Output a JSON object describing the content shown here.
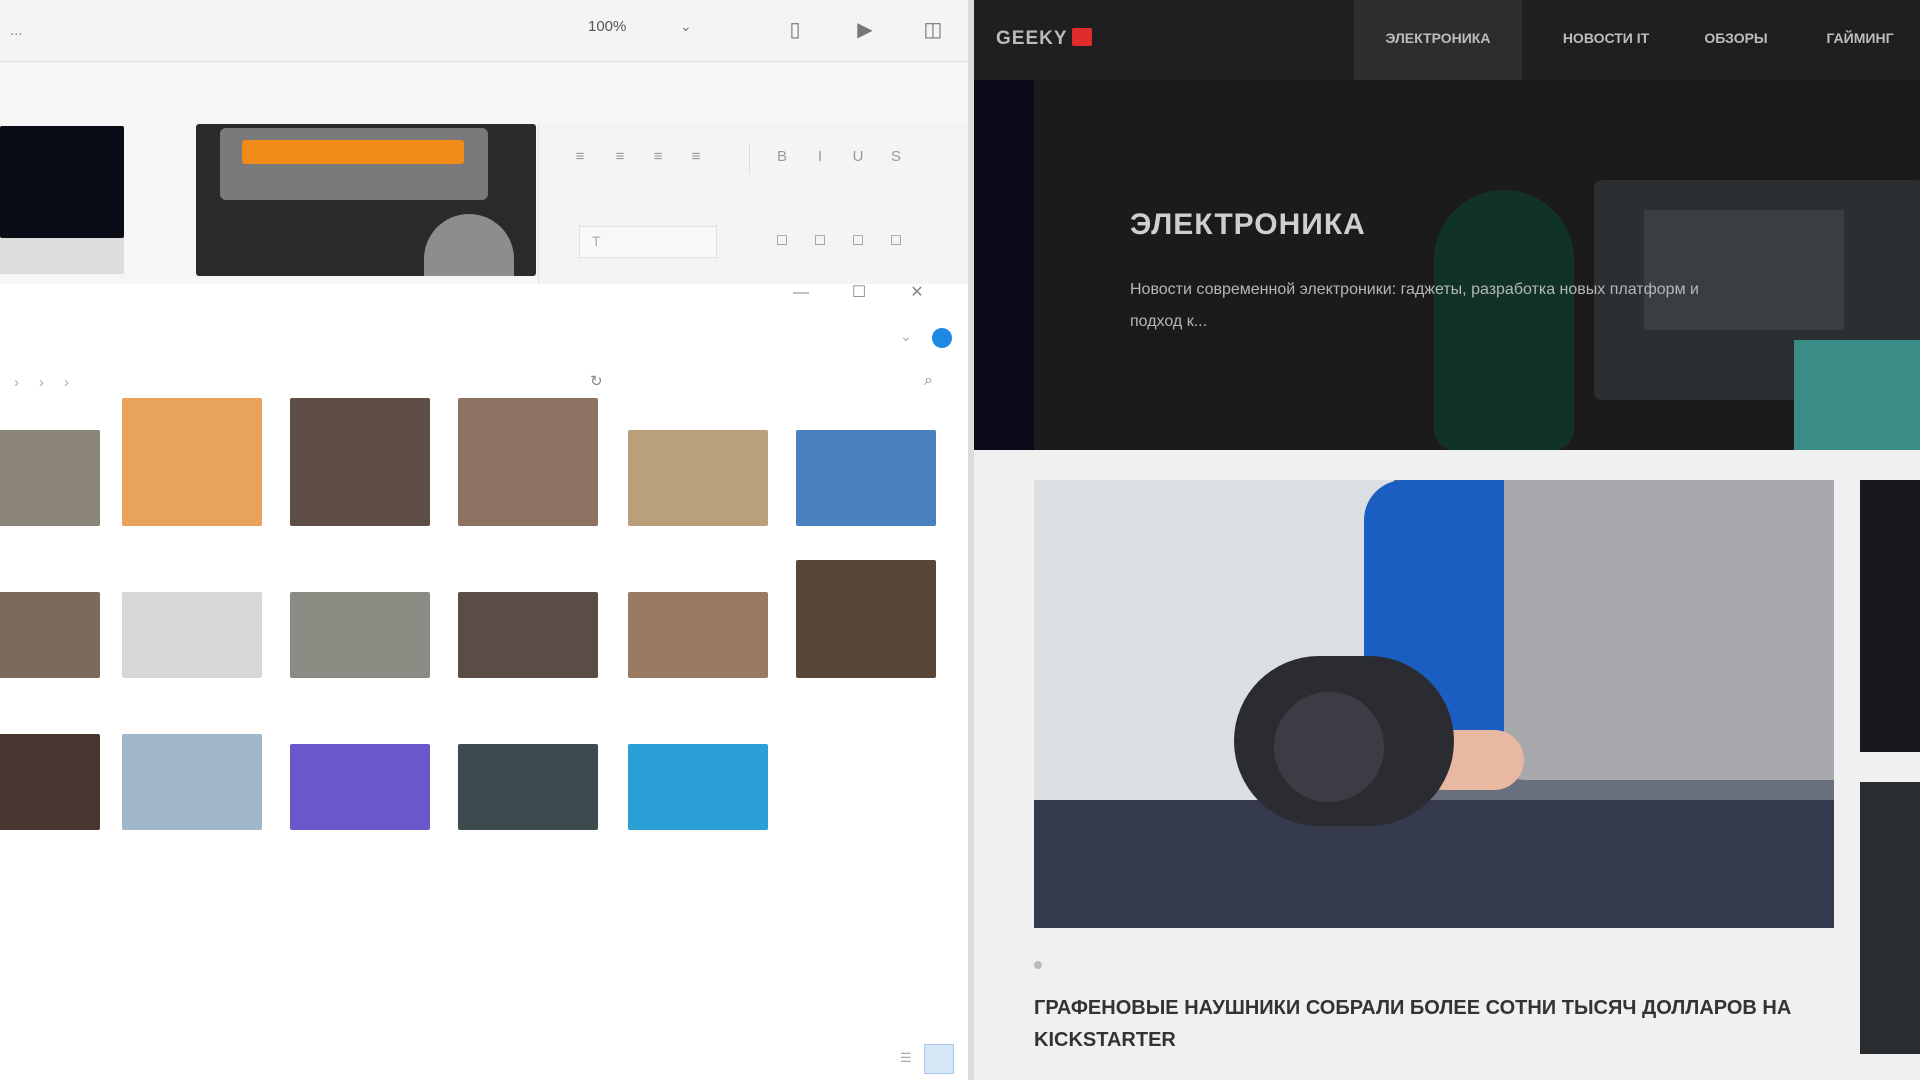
{
  "editor": {
    "crumb": "...",
    "zoom": "100%",
    "slide_label": "",
    "font_placeholder": "",
    "toolbar_icons": [
      "bar-icon",
      "play-icon",
      "camera-icon"
    ],
    "format_icons": [
      "align-left-icon",
      "align-center-icon",
      "align-right-icon",
      "align-justify-icon",
      "bold-icon",
      "italic-icon",
      "underline-icon",
      "strike-icon"
    ],
    "arrange_icons": [
      "arrange-1-icon",
      "arrange-2-icon",
      "arrange-3-icon",
      "arrange-4-icon"
    ]
  },
  "explorer": {
    "window_buttons": [
      "—",
      "☐",
      "✕"
    ],
    "path": [
      "",
      "",
      "",
      ""
    ],
    "search_placeholder": "",
    "photos": [
      {
        "label": "",
        "color": "#8b8478",
        "row": 0
      },
      {
        "label": "",
        "color": "#e9a25a",
        "row": 0
      },
      {
        "label": "",
        "color": "#5e4d45",
        "row": 0
      },
      {
        "label": "",
        "color": "#8c7362",
        "row": 0
      },
      {
        "label": "",
        "color": "#b9a07b",
        "row": 0
      },
      {
        "label": "",
        "color": "#4a7fc0",
        "row": 0
      },
      {
        "label": "",
        "color": "#7d6a5a",
        "row": 1
      },
      {
        "label": "",
        "color": "#d7d7d7",
        "row": 1
      },
      {
        "label": "",
        "color": "#8b8a83",
        "row": 1
      },
      {
        "label": "",
        "color": "#5b4d45",
        "row": 1
      },
      {
        "label": "",
        "color": "#9a7a62",
        "row": 1
      },
      {
        "label": "",
        "color": "#5a4636",
        "row": 1
      },
      {
        "label": "",
        "color": "#4a3530",
        "row": 2
      },
      {
        "label": "",
        "color": "#9fb7c9",
        "row": 2
      },
      {
        "label": "",
        "color": "#6b57c9",
        "row": 2
      },
      {
        "label": "",
        "color": "#3b4b4e",
        "row": 2
      },
      {
        "label": "",
        "color": "#2aa0d6",
        "row": 2
      }
    ]
  },
  "browser": {
    "logo": "GEEKY",
    "nav": [
      {
        "label": "ЭЛЕКТРОНИКА",
        "active": true
      },
      {
        "label": "НОВОСТИ IT",
        "active": false
      },
      {
        "label": "ОБЗОРЫ",
        "active": false
      },
      {
        "label": "ГАЙМИНГ",
        "active": false
      }
    ],
    "hero": {
      "title": "ЭЛЕКТРОНИКА",
      "description": "Новости современной электроники: гаджеты, разработка новых платформ и подход к..."
    },
    "article": {
      "category": "",
      "date": "",
      "title": "ГРАФЕНОВЫЕ НАУШНИКИ СОБРАЛИ БОЛЕЕ СОТНИ ТЫСЯЧ ДОЛЛАРОВ НА KICKSTARTER"
    }
  }
}
